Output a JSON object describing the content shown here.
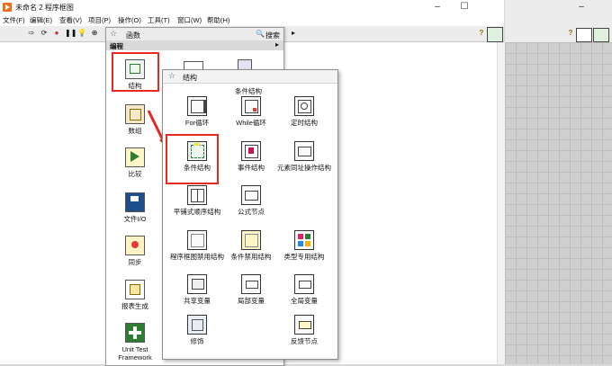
{
  "window": {
    "title": "未命名 2 程序框图",
    "menu": [
      "文件(F)",
      "编辑(E)",
      "查看(V)",
      "项目(P)",
      "操作(O)",
      "工具(T)",
      "窗口(W)",
      "帮助(H)"
    ]
  },
  "palette": {
    "title": "函数",
    "search_label": "搜索",
    "category": "编程",
    "items": [
      {
        "label": "结构",
        "icon": "structures-icon"
      },
      {
        "label": "数组",
        "icon": "array-icon"
      },
      {
        "label": "比较",
        "icon": "comparison-icon"
      },
      {
        "label": "文件I/O",
        "icon": "file-io-icon"
      },
      {
        "label": "同步",
        "icon": "synchronization-icon"
      },
      {
        "label": "报表生成",
        "icon": "report-generation-icon"
      },
      {
        "label": "Unit Test Framework",
        "icon": "unit-test-icon"
      }
    ]
  },
  "structures": {
    "title": "结构",
    "hover_label": "条件结构",
    "items": [
      {
        "label": "For循环",
        "icon": "for-loop-icon"
      },
      {
        "label": "While循环",
        "icon": "while-loop-icon"
      },
      {
        "label": "定时结构",
        "icon": "timed-structure-icon"
      },
      {
        "label": "条件结构",
        "icon": "case-structure-icon"
      },
      {
        "label": "事件结构",
        "icon": "event-structure-icon"
      },
      {
        "label": "元素同址操作结构",
        "icon": "in-place-element-icon"
      },
      {
        "label": "平铺式顺序结构",
        "icon": "flat-sequence-icon"
      },
      {
        "label": "公式节点",
        "icon": "formula-node-icon"
      },
      {
        "label": "程序框图禁用结构",
        "icon": "diagram-disable-icon"
      },
      {
        "label": "条件禁用结构",
        "icon": "conditional-disable-icon"
      },
      {
        "label": "类型专用结构",
        "icon": "type-specialization-icon"
      },
      {
        "label": "共享变量",
        "icon": "shared-variable-icon"
      },
      {
        "label": "局部变量",
        "icon": "local-variable-icon"
      },
      {
        "label": "全局变量",
        "icon": "global-variable-icon"
      },
      {
        "label": "修饰",
        "icon": "decorations-icon"
      },
      {
        "label": "反馈节点",
        "icon": "feedback-node-icon"
      }
    ]
  },
  "colors": {
    "highlight": "#e8281e",
    "accent_orange": "#f26a1a"
  }
}
